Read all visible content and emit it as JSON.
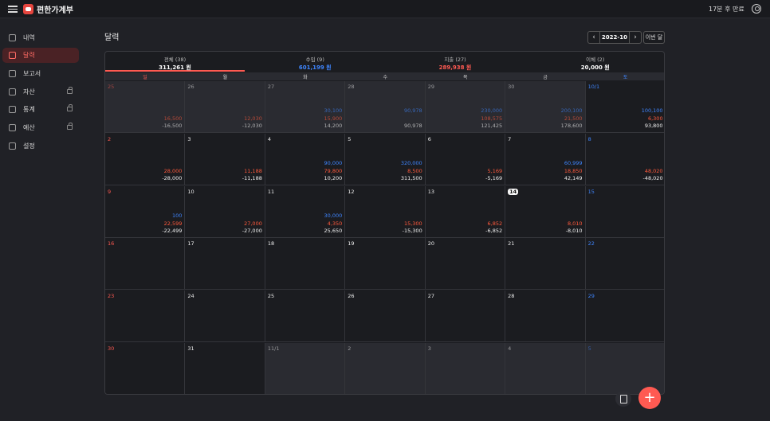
{
  "header": {
    "app_title": "편한가계부",
    "expire_text": "17분 후 만료",
    "icons": [
      "menu-icon",
      "logo-icon",
      "account-icon"
    ]
  },
  "sidebar": {
    "items": [
      {
        "label": "내역",
        "icon": "receipt-icon",
        "locked": false,
        "active": false
      },
      {
        "label": "달력",
        "icon": "calendar-icon",
        "locked": false,
        "active": true
      },
      {
        "label": "보고서",
        "icon": "report-icon",
        "locked": false,
        "active": false
      },
      {
        "label": "자산",
        "icon": "wallet-icon",
        "locked": true,
        "active": false
      },
      {
        "label": "통계",
        "icon": "stats-icon",
        "locked": true,
        "active": false
      },
      {
        "label": "예산",
        "icon": "budget-icon",
        "locked": true,
        "active": false
      },
      {
        "label": "설정",
        "icon": "gear-icon",
        "locked": false,
        "active": false
      }
    ]
  },
  "page": {
    "title": "달력",
    "month": "2022-10",
    "prev_month_label": "이번 달",
    "prev_arrow": "‹",
    "next_arrow": "›"
  },
  "colors": {
    "accent": "#ff5a52",
    "income": "#3f86ff",
    "expense": "#ff5a3c"
  },
  "summary": [
    {
      "title": "전체 (38)",
      "value": "311,261 원",
      "color": "#ffffff"
    },
    {
      "title": "수입 (9)",
      "value": "601,199 원",
      "color": "#3f86ff"
    },
    {
      "title": "지출 (27)",
      "value": "289,938 원",
      "color": "#ff5a52"
    },
    {
      "title": "이체 (2)",
      "value": "20,000 원",
      "color": "#ffffff"
    }
  ],
  "weekdays": [
    "일",
    "월",
    "화",
    "수",
    "목",
    "금",
    "토"
  ],
  "weeks": [
    [
      {
        "d": "25",
        "o": true,
        "e": "16,500",
        "n": "-16,500"
      },
      {
        "d": "26",
        "o": true,
        "e": "12,030",
        "n": "-12,030"
      },
      {
        "d": "27",
        "o": true,
        "i": "30,100",
        "e": "15,900",
        "n": "14,200"
      },
      {
        "d": "28",
        "o": true,
        "i": "90,978",
        "n": "90,978"
      },
      {
        "d": "29",
        "o": true,
        "i": "230,000",
        "e": "108,575",
        "n": "121,425"
      },
      {
        "d": "30",
        "o": true,
        "i": "200,100",
        "e": "21,500",
        "n": "178,600"
      },
      {
        "d": "10/1",
        "i": "100,100",
        "e": "6,300",
        "n": "93,800"
      }
    ],
    [
      {
        "d": "2",
        "e": "28,000",
        "n": "-28,000"
      },
      {
        "d": "3",
        "e": "11,188",
        "n": "-11,188"
      },
      {
        "d": "4",
        "i": "90,000",
        "e": "79,800",
        "n": "10,200"
      },
      {
        "d": "5",
        "i": "320,000",
        "e": "8,500",
        "n": "311,500"
      },
      {
        "d": "6",
        "e": "5,169",
        "n": "-5,169"
      },
      {
        "d": "7",
        "i": "60,999",
        "e": "18,850",
        "n": "42,149"
      },
      {
        "d": "8",
        "e": "48,020",
        "n": "-48,020"
      }
    ],
    [
      {
        "d": "9",
        "i": "100",
        "e": "22,599",
        "n": "-22,499"
      },
      {
        "d": "10",
        "e": "27,000",
        "n": "-27,000"
      },
      {
        "d": "11",
        "i": "30,000",
        "e": "4,350",
        "n": "25,650"
      },
      {
        "d": "12",
        "e": "15,300",
        "n": "-15,300"
      },
      {
        "d": "13",
        "e": "6,852",
        "n": "-6,852"
      },
      {
        "d": "14",
        "today": true,
        "e": "8,010",
        "n": "-8,010"
      },
      {
        "d": "15"
      }
    ],
    [
      {
        "d": "16"
      },
      {
        "d": "17"
      },
      {
        "d": "18"
      },
      {
        "d": "19"
      },
      {
        "d": "20"
      },
      {
        "d": "21"
      },
      {
        "d": "22"
      }
    ],
    [
      {
        "d": "23"
      },
      {
        "d": "24"
      },
      {
        "d": "25"
      },
      {
        "d": "26"
      },
      {
        "d": "27"
      },
      {
        "d": "28"
      },
      {
        "d": "29"
      }
    ],
    [
      {
        "d": "30"
      },
      {
        "d": "31"
      },
      {
        "d": "11/1",
        "o": true
      },
      {
        "d": "2",
        "o": true
      },
      {
        "d": "3",
        "o": true
      },
      {
        "d": "4",
        "o": true
      },
      {
        "d": "5",
        "o": true
      }
    ]
  ],
  "actions": {
    "list_icon": "list-icon",
    "add_icon": "plus-icon",
    "add_label": "+"
  }
}
